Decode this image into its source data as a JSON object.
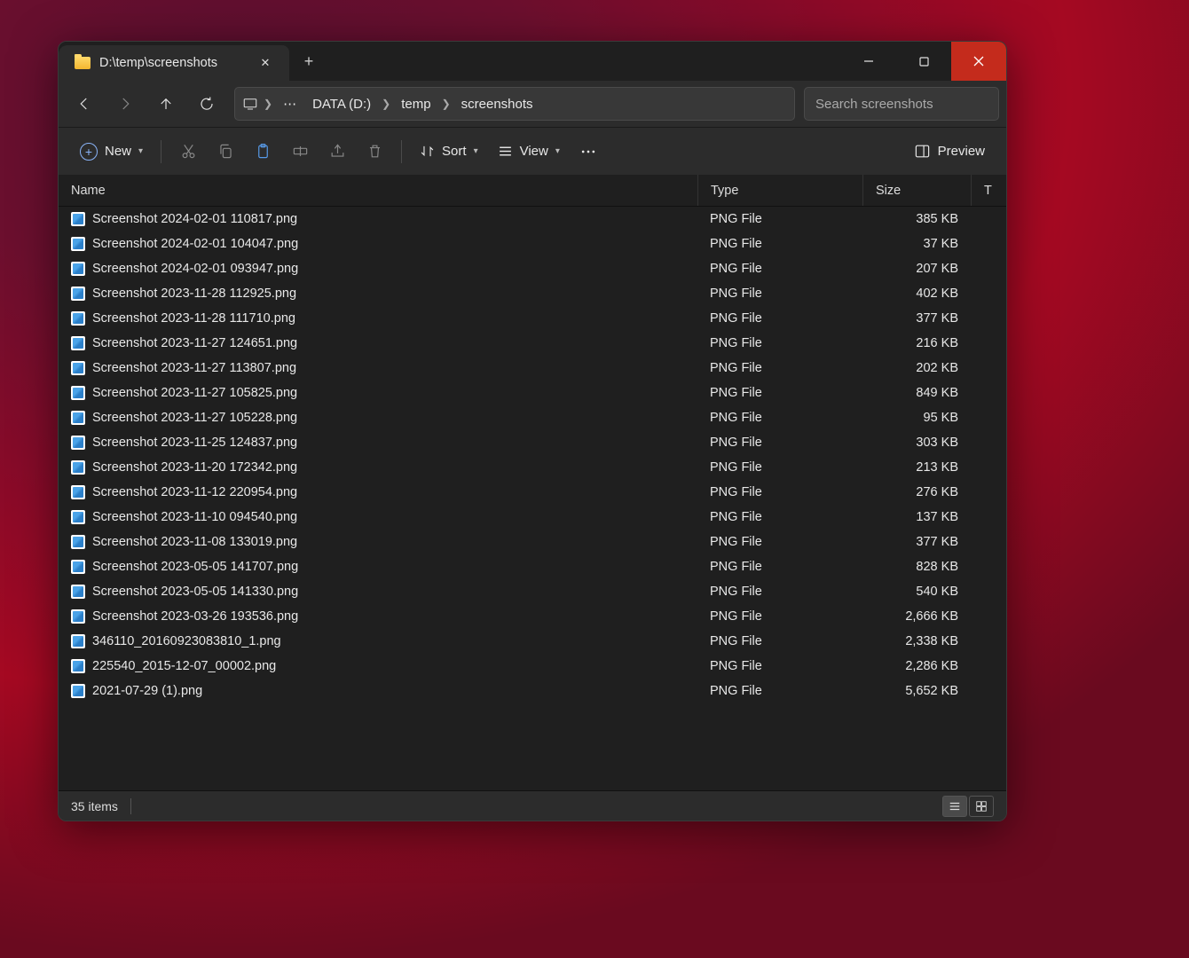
{
  "tab": {
    "title": "D:\\temp\\screenshots"
  },
  "breadcrumb": {
    "segments": [
      "DATA (D:)",
      "temp",
      "screenshots"
    ]
  },
  "search": {
    "placeholder": "Search screenshots"
  },
  "toolbar": {
    "new": "New",
    "sort": "Sort",
    "view": "View",
    "preview": "Preview"
  },
  "columns": {
    "name": "Name",
    "type": "Type",
    "size": "Size",
    "extra": "T"
  },
  "files": [
    {
      "name": "Screenshot 2024-02-01 110817.png",
      "type": "PNG File",
      "size": "385 KB"
    },
    {
      "name": "Screenshot 2024-02-01 104047.png",
      "type": "PNG File",
      "size": "37 KB"
    },
    {
      "name": "Screenshot 2024-02-01 093947.png",
      "type": "PNG File",
      "size": "207 KB"
    },
    {
      "name": "Screenshot 2023-11-28 112925.png",
      "type": "PNG File",
      "size": "402 KB"
    },
    {
      "name": "Screenshot 2023-11-28 111710.png",
      "type": "PNG File",
      "size": "377 KB"
    },
    {
      "name": "Screenshot 2023-11-27 124651.png",
      "type": "PNG File",
      "size": "216 KB"
    },
    {
      "name": "Screenshot 2023-11-27 113807.png",
      "type": "PNG File",
      "size": "202 KB"
    },
    {
      "name": "Screenshot 2023-11-27 105825.png",
      "type": "PNG File",
      "size": "849 KB"
    },
    {
      "name": "Screenshot 2023-11-27 105228.png",
      "type": "PNG File",
      "size": "95 KB"
    },
    {
      "name": "Screenshot 2023-11-25 124837.png",
      "type": "PNG File",
      "size": "303 KB"
    },
    {
      "name": "Screenshot 2023-11-20 172342.png",
      "type": "PNG File",
      "size": "213 KB"
    },
    {
      "name": "Screenshot 2023-11-12 220954.png",
      "type": "PNG File",
      "size": "276 KB"
    },
    {
      "name": "Screenshot 2023-11-10 094540.png",
      "type": "PNG File",
      "size": "137 KB"
    },
    {
      "name": "Screenshot 2023-11-08 133019.png",
      "type": "PNG File",
      "size": "377 KB"
    },
    {
      "name": "Screenshot 2023-05-05 141707.png",
      "type": "PNG File",
      "size": "828 KB"
    },
    {
      "name": "Screenshot 2023-05-05 141330.png",
      "type": "PNG File",
      "size": "540 KB"
    },
    {
      "name": "Screenshot 2023-03-26 193536.png",
      "type": "PNG File",
      "size": "2,666 KB"
    },
    {
      "name": "346110_20160923083810_1.png",
      "type": "PNG File",
      "size": "2,338 KB"
    },
    {
      "name": "225540_2015-12-07_00002.png",
      "type": "PNG File",
      "size": "2,286 KB"
    },
    {
      "name": "2021-07-29 (1).png",
      "type": "PNG File",
      "size": "5,652 KB"
    }
  ],
  "status": {
    "items": "35 items"
  }
}
